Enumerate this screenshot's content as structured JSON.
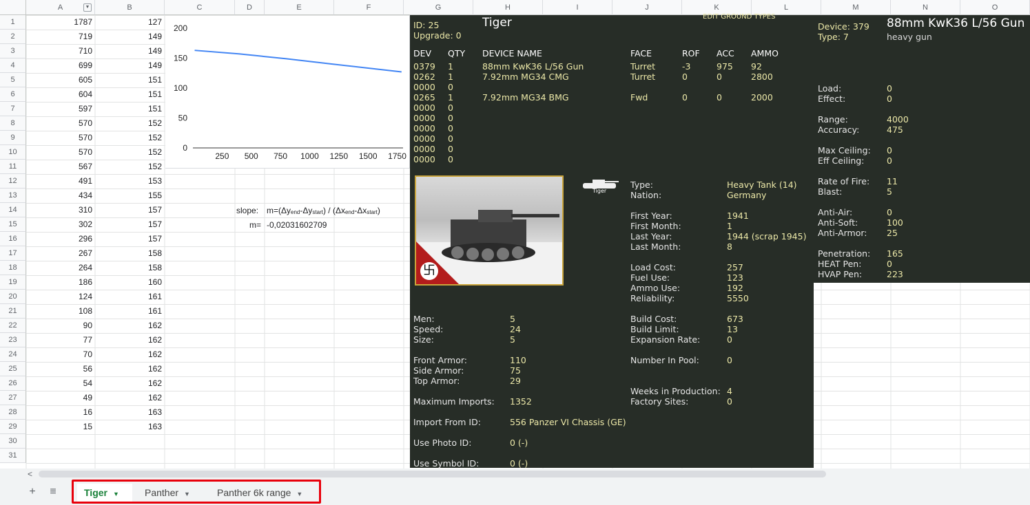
{
  "columns": [
    "A",
    "B",
    "C",
    "D",
    "E",
    "F",
    "G",
    "H",
    "I",
    "J",
    "K",
    "L",
    "M",
    "N",
    "O"
  ],
  "rows": [
    "1",
    "2",
    "3",
    "4",
    "5",
    "6",
    "7",
    "8",
    "9",
    "10",
    "11",
    "12",
    "13",
    "14",
    "15",
    "16",
    "17",
    "18",
    "19",
    "20",
    "21",
    "22",
    "23",
    "24",
    "25",
    "26",
    "27",
    "28",
    "29",
    "30",
    "31"
  ],
  "col_a": [
    "1787",
    "719",
    "710",
    "699",
    "605",
    "604",
    "597",
    "570",
    "570",
    "570",
    "567",
    "491",
    "434",
    "310",
    "302",
    "296",
    "267",
    "264",
    "186",
    "124",
    "108",
    "90",
    "77",
    "70",
    "56",
    "54",
    "49",
    "16",
    "15"
  ],
  "col_b": [
    "127",
    "149",
    "149",
    "149",
    "151",
    "151",
    "151",
    "152",
    "152",
    "152",
    "152",
    "153",
    "155",
    "157",
    "157",
    "157",
    "158",
    "158",
    "160",
    "161",
    "161",
    "162",
    "162",
    "162",
    "162",
    "162",
    "162",
    "163",
    "163"
  ],
  "chart_data": {
    "type": "line",
    "x": [
      15,
      400,
      800,
      1200,
      1787
    ],
    "y": [
      163,
      157,
      149,
      140,
      127
    ],
    "xticks": [
      "250",
      "500",
      "750",
      "1000",
      "1250",
      "1500",
      "1750"
    ],
    "xtick_values": [
      250,
      500,
      750,
      1000,
      1250,
      1500,
      1750
    ],
    "yticks": [
      "0",
      "50",
      "100",
      "150",
      "200"
    ],
    "ytick_values": [
      0,
      50,
      100,
      150,
      200
    ],
    "xlim": [
      0,
      1800
    ],
    "ylim": [
      0,
      200
    ],
    "title": "",
    "xlabel": "",
    "ylabel": "",
    "color": "#4285f4",
    "grid": false
  },
  "slope": {
    "label": "slope:",
    "formula": "m=(Δy",
    "sub_end": "end",
    "mid1": "-Δy",
    "sub_start": "start",
    "mid2": ") / (Δx",
    "mid3": "-Δx",
    "close": ")",
    "m_label": "m=",
    "m_value": "-0,02031602709"
  },
  "game": {
    "id_line": "ID: 25",
    "upgrade_line": "Upgrade: 0",
    "name": "Tiger",
    "header_text": "EDIT GROUND TYPES",
    "table_headers": {
      "dev": "DEV",
      "qty": "QTY",
      "name": "DEVICE NAME",
      "face": "FACE",
      "rof": "ROF",
      "acc": "ACC",
      "ammo": "AMMO"
    },
    "devices": [
      {
        "dev": "0379",
        "qty": "1",
        "name": "88mm KwK36 L/56 Gun",
        "face": "Turret",
        "rof": "-3",
        "acc": "975",
        "ammo": "92"
      },
      {
        "dev": "0262",
        "qty": "1",
        "name": "7.92mm MG34 CMG",
        "face": "Turret",
        "rof": "0",
        "acc": "0",
        "ammo": "2800"
      },
      {
        "dev": "0000",
        "qty": "0",
        "name": "",
        "face": "",
        "rof": "",
        "acc": "",
        "ammo": ""
      },
      {
        "dev": "0265",
        "qty": "1",
        "name": "7.92mm MG34 BMG",
        "face": "Fwd",
        "rof": "0",
        "acc": "0",
        "ammo": "2000"
      },
      {
        "dev": "0000",
        "qty": "0",
        "name": "",
        "face": "",
        "rof": "",
        "acc": "",
        "ammo": ""
      },
      {
        "dev": "0000",
        "qty": "0",
        "name": "",
        "face": "",
        "rof": "",
        "acc": "",
        "ammo": ""
      },
      {
        "dev": "0000",
        "qty": "0",
        "name": "",
        "face": "",
        "rof": "",
        "acc": "",
        "ammo": ""
      },
      {
        "dev": "0000",
        "qty": "0",
        "name": "",
        "face": "",
        "rof": "",
        "acc": "",
        "ammo": ""
      },
      {
        "dev": "0000",
        "qty": "0",
        "name": "",
        "face": "",
        "rof": "",
        "acc": "",
        "ammo": ""
      },
      {
        "dev": "0000",
        "qty": "0",
        "name": "",
        "face": "",
        "rof": "",
        "acc": "",
        "ammo": ""
      }
    ],
    "symbol_caption": "Tiger",
    "type_label": "Type:",
    "type_value": "Heavy Tank (14)",
    "nation_label": "Nation:",
    "nation_value": "Germany",
    "first_year_label": "First Year:",
    "first_year_value": "1941",
    "first_month_label": "First Month:",
    "first_month_value": "1",
    "last_year_label": "Last Year:",
    "last_year_value": "1944 (scrap 1945)",
    "last_month_label": "Last Month:",
    "last_month_value": "8",
    "load_cost_label": "Load Cost:",
    "load_cost_value": "257",
    "fuel_use_label": "Fuel Use:",
    "fuel_use_value": "123",
    "ammo_use_label": "Ammo Use:",
    "ammo_use_value": "192",
    "reliability_label": "Reliability:",
    "reliability_value": "5550",
    "men_label": "Men:",
    "men_value": "5",
    "speed_label": "Speed:",
    "speed_value": "24",
    "size_label": "Size:",
    "size_value": "5",
    "build_cost_label": "Build Cost:",
    "build_cost_value": "673",
    "build_limit_label": "Build Limit:",
    "build_limit_value": "13",
    "expansion_label": "Expansion Rate:",
    "expansion_value": "0",
    "front_armor_label": "Front Armor:",
    "front_armor_value": "110",
    "side_armor_label": "Side Armor:",
    "side_armor_value": "75",
    "top_armor_label": "Top Armor:",
    "top_armor_value": "29",
    "pool_label": "Number In Pool:",
    "pool_value": "0",
    "weeks_label": "Weeks in Production:",
    "weeks_value": "4",
    "factory_label": "Factory Sites:",
    "factory_value": "0",
    "max_imports_label": "Maximum Imports:",
    "max_imports_value": "1352",
    "import_from_label": "Import From ID:",
    "import_from_value": "556  Panzer VI Chassis (GE)",
    "photo_label": "Use Photo ID:",
    "photo_value": "0  (-)",
    "symbol_label": "Use Symbol ID:",
    "symbol_value": "0  (-)"
  },
  "device": {
    "device_line": "Device: 379",
    "type_line": "Type:   7",
    "name": "88mm KwK36 L/56 Gun",
    "subtype": "heavy gun",
    "stats": [
      {
        "label": "Load:",
        "value": "0"
      },
      {
        "label": "Effect:",
        "value": "0"
      },
      {
        "label": "Range:",
        "value": "4000"
      },
      {
        "label": "Accuracy:",
        "value": "475"
      },
      {
        "label": "Max Ceiling:",
        "value": "0"
      },
      {
        "label": "Eff Ceiling:",
        "value": "0"
      },
      {
        "label": "Rate of Fire:",
        "value": "11"
      },
      {
        "label": "Blast:",
        "value": "5"
      },
      {
        "label": "Anti-Air:",
        "value": "0"
      },
      {
        "label": "Anti-Soft:",
        "value": "100"
      },
      {
        "label": "Anti-Armor:",
        "value": "25"
      },
      {
        "label": "Penetration:",
        "value": "165"
      },
      {
        "label": "HEAT Pen:",
        "value": "0"
      },
      {
        "label": "HVAP Pen:",
        "value": "223"
      }
    ]
  },
  "tabs": [
    {
      "label": "Tiger",
      "active": true
    },
    {
      "label": "Panther",
      "active": false
    },
    {
      "label": "Panther 6k range",
      "active": false
    }
  ],
  "colors": {
    "accent_green": "#188038",
    "highlight_red": "#e8000b",
    "game_bg": "#272d27",
    "game_text": "#ece8a8"
  }
}
